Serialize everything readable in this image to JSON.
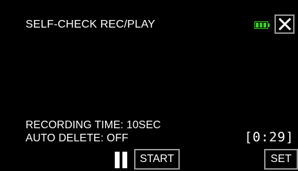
{
  "screen": {
    "title": "SELF-CHECK REC/PLAY",
    "background_color": "#000000",
    "text_color": "#ffffff"
  },
  "battery": {
    "icon": "battery-icon",
    "color": "#3ecf2a"
  },
  "close_button": {
    "icon": "close-icon"
  },
  "info": {
    "recording_time": "RECORDING TIME: 10SEC",
    "auto_delete": "AUTO DELETE: OFF"
  },
  "counter": "[0:29]",
  "controls": {
    "pause_icon": "pause-icon",
    "start_label": "START",
    "set_label": "SET"
  }
}
